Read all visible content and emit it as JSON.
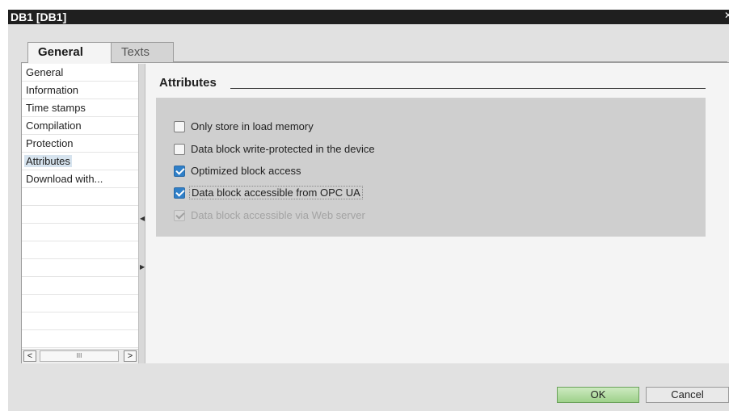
{
  "window": {
    "title": "DB1 [DB1]"
  },
  "tabs": [
    {
      "label": "General",
      "active": true
    },
    {
      "label": "Texts",
      "active": false
    }
  ],
  "nav": {
    "items": [
      {
        "label": "General",
        "selected": false
      },
      {
        "label": "Information",
        "selected": false
      },
      {
        "label": "Time stamps",
        "selected": false
      },
      {
        "label": "Compilation",
        "selected": false
      },
      {
        "label": "Protection",
        "selected": false
      },
      {
        "label": "Attributes",
        "selected": true
      },
      {
        "label": "Download with...",
        "selected": false
      }
    ],
    "scroll_left": "<",
    "scroll_right": ">",
    "scroll_thumb": "III"
  },
  "attributes": {
    "title": "Attributes",
    "options": [
      {
        "label": "Only store in load memory",
        "checked": false,
        "enabled": true
      },
      {
        "label": "Data block write-protected in the device",
        "checked": false,
        "enabled": true
      },
      {
        "label": "Optimized block access",
        "checked": true,
        "enabled": true
      },
      {
        "label": "Data block accessible from OPC UA",
        "checked": true,
        "enabled": true
      },
      {
        "label": "Data block accessible via Web server",
        "checked": true,
        "enabled": false
      }
    ]
  },
  "buttons": {
    "ok": "OK",
    "cancel": "Cancel"
  },
  "colors": {
    "ok_button": "#9ed18a",
    "checkbox_checked": "#2f7fc8",
    "titlebar": "#1f1f1f"
  }
}
